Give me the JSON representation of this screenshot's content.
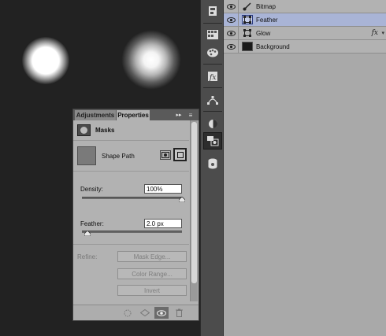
{
  "layers": [
    {
      "name": "Bitmap",
      "thumb": "brush-icon",
      "selected": false,
      "fx": ""
    },
    {
      "name": "Feather",
      "thumb": "vector-path-icon",
      "selected": true,
      "fx": ""
    },
    {
      "name": "Glow",
      "thumb": "vector-path-icon",
      "selected": false,
      "fx": "fx"
    },
    {
      "name": "Background",
      "thumb": "black-fill",
      "selected": false,
      "fx": ""
    }
  ],
  "properties_panel": {
    "tabs": [
      "Adjustments",
      "Properties"
    ],
    "active_tab": "Properties",
    "collapse_glyph": "▸▸",
    "menu_glyph": "≡",
    "section_label": "Masks",
    "shape_label": "Shape Path",
    "density": {
      "label": "Density:",
      "value": "100%",
      "level_percent": 100
    },
    "feather": {
      "label": "Feather:",
      "value": "2.0 px",
      "level_fraction": 0.02
    },
    "refine": {
      "label": "Refine:",
      "buttons": [
        "Mask Edge...",
        "Color Range...",
        "Invert"
      ]
    }
  },
  "tools": [
    "history-icon",
    "swatches-grid-icon",
    "palette-icon",
    "fx-script-icon",
    "path-tool-icon",
    "adjustment-circle-icon",
    "properties-mask-icon",
    "3d-cylinder-icon"
  ],
  "colors": {
    "canvas": "#222222",
    "selected_layer": "#a9b4d6",
    "panel": "#b2b2b2"
  }
}
